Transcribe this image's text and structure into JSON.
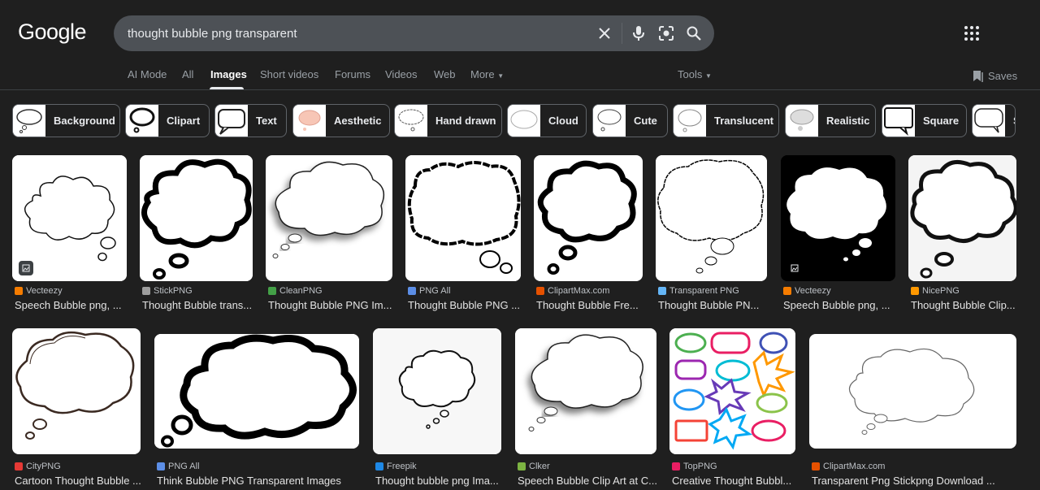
{
  "logo": "Google",
  "search": {
    "query": "thought bubble png transparent"
  },
  "tabs": [
    {
      "label": "AI Mode"
    },
    {
      "label": "All"
    },
    {
      "label": "Images",
      "active": true
    },
    {
      "label": "Short videos"
    },
    {
      "label": "Forums"
    },
    {
      "label": "Videos"
    },
    {
      "label": "Web"
    },
    {
      "label": "More"
    },
    {
      "label": "Tools"
    }
  ],
  "saves_label": "Saves",
  "chips": [
    {
      "label": "Background"
    },
    {
      "label": "Clipart"
    },
    {
      "label": "Text"
    },
    {
      "label": "Aesthetic"
    },
    {
      "label": "Hand drawn"
    },
    {
      "label": "Cloud"
    },
    {
      "label": "Cute"
    },
    {
      "label": "Translucent"
    },
    {
      "label": "Realistic"
    },
    {
      "label": "Square"
    },
    {
      "label": "S"
    }
  ],
  "results": [
    {
      "source": "Vecteezy",
      "title": "Speech Bubble png, ...",
      "fav_color": "#f57c00"
    },
    {
      "source": "StickPNG",
      "title": "Thought Bubble trans...",
      "fav_color": "#9e9e9e"
    },
    {
      "source": "CleanPNG",
      "title": "Thought Bubble PNG Im...",
      "fav_color": "#43a047"
    },
    {
      "source": "PNG All",
      "title": "Thought Bubble PNG ...",
      "fav_color": "#5c8ee6"
    },
    {
      "source": "ClipartMax.com",
      "title": "Thought Bubble Fre...",
      "fav_color": "#e65100"
    },
    {
      "source": "Transparent PNG",
      "title": "Thought Bubble PN...",
      "fav_color": "#64b5f6"
    },
    {
      "source": "Vecteezy",
      "title": "Speech Bubble png, ...",
      "fav_color": "#f57c00"
    },
    {
      "source": "NicePNG",
      "title": "Thought Bubble Clip...",
      "fav_color": "#ff9800"
    },
    {
      "source": "CityPNG",
      "title": "Cartoon Thought Bubble ...",
      "fav_color": "#e53935"
    },
    {
      "source": "PNG All",
      "title": "Think Bubble PNG Transparent Images",
      "fav_color": "#5c8ee6"
    },
    {
      "source": "Freepik",
      "title": "Thought bubble png Ima...",
      "fav_color": "#1e88e5"
    },
    {
      "source": "Clker",
      "title": "Speech Bubble Clip Art at C...",
      "fav_color": "#7cb342"
    },
    {
      "source": "TopPNG",
      "title": "Creative Thought Bubbl...",
      "fav_color": "#e91e63"
    },
    {
      "source": "ClipartMax.com",
      "title": "Transparent Png Stickpng Download ...",
      "fav_color": "#e65100"
    }
  ]
}
